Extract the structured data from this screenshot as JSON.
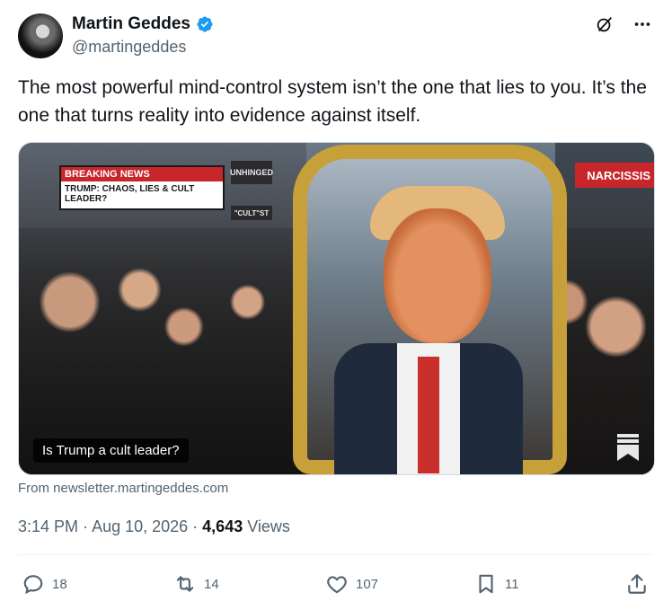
{
  "author": {
    "name": "Martin Geddes",
    "handle": "@martingeddes",
    "verified": true
  },
  "header_icons": [
    "grok-icon",
    "more-icon"
  ],
  "tweet": {
    "text": "The most powerful mind-control system isn’t the one that lies to you. It’s the one that turns reality into evidence against itself."
  },
  "media": {
    "caption": "Is Trump a cult leader?",
    "banner_top": "BREAKING NEWS",
    "banner_bottom": "TRUMP: CHAOS, LIES & CULT LEADER?",
    "sign_unhinged": "UNHINGED",
    "sign_cult": "\"CULT\"ST",
    "sign_narciss": "NARCISSIS",
    "corner_icon": "bookmark-stack-icon"
  },
  "source": "From newsletter.martingeddes.com",
  "meta": {
    "time": "3:14 PM",
    "sep1": " · ",
    "date": "Aug 10, 2026",
    "sep2": " · ",
    "views_count": "4,643",
    "views_label": " Views"
  },
  "actions": {
    "replies": "18",
    "retweets": "14",
    "likes": "107",
    "bookmarks": "11"
  },
  "colors": {
    "text": "#0f1419",
    "secondary": "#536471",
    "verified": "#1d9bf0",
    "divider": "#eff3f4"
  }
}
